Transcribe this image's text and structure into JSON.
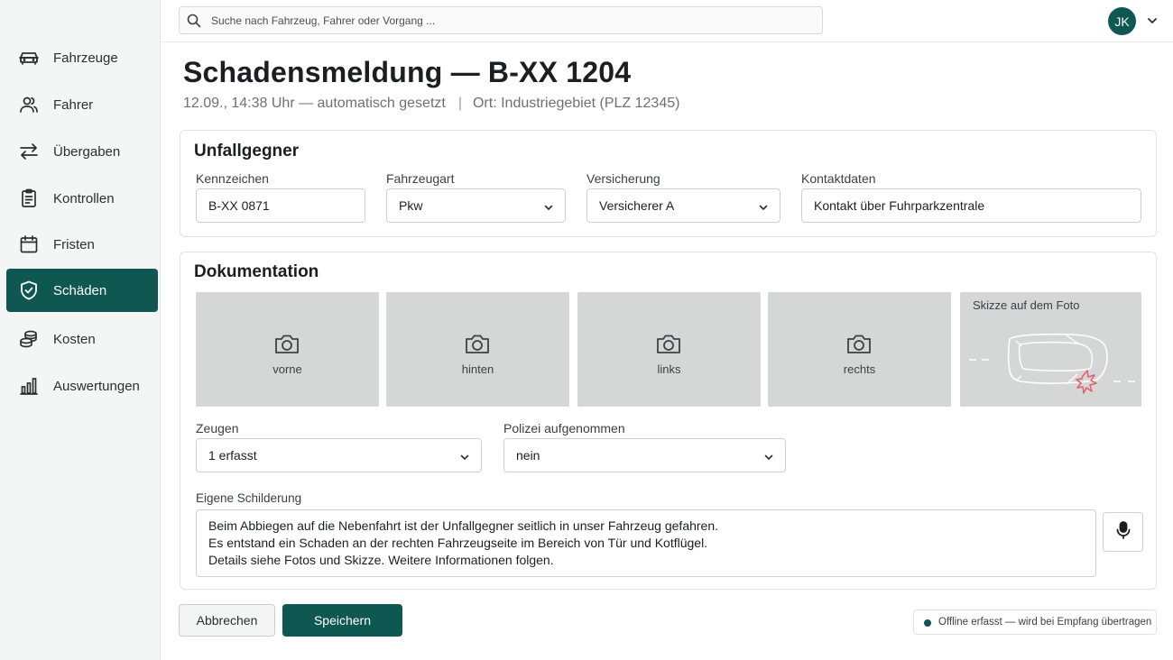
{
  "sidebar": {
    "items": [
      {
        "label": "Fahrzeuge",
        "icon": "car-icon"
      },
      {
        "label": "Fahrer",
        "icon": "users-icon"
      },
      {
        "label": "Übergaben",
        "icon": "swap-arrows-icon"
      },
      {
        "label": "Kontrollen",
        "icon": "clipboard-icon"
      },
      {
        "label": "Fristen",
        "icon": "calendar-icon"
      },
      {
        "label": "Schäden",
        "icon": "shield-icon",
        "active": true
      },
      {
        "label": "Kosten",
        "icon": "coins-icon"
      },
      {
        "label": "Auswertungen",
        "icon": "bar-chart-icon"
      }
    ]
  },
  "topbar": {
    "search_placeholder": "Suche nach Fahrzeug, Fahrer oder Vorgang ...",
    "avatar_initials": "JK"
  },
  "header": {
    "title": "Schadensmeldung — B-XX 1204",
    "timestamp": "12.09., 14:38 Uhr — automatisch gesetzt",
    "separator": "|",
    "location": "Ort: Industriegebiet (PLZ 12345)"
  },
  "opponent": {
    "title": "Unfallgegner",
    "plate_label": "Kennzeichen",
    "plate_value": "B-XX 0871",
    "vehicle_type_label": "Fahrzeugart",
    "vehicle_type_value": "Pkw",
    "insurance_label": "Versicherung",
    "insurance_value": "Versicherer A",
    "contact_label": "Kontaktdaten",
    "contact_value": "Kontakt über Fuhrparkzentrale"
  },
  "documentation": {
    "title": "Dokumentation",
    "photos": [
      {
        "caption": "vorne",
        "icon": "camera-icon"
      },
      {
        "caption": "hinten",
        "icon": "camera-icon"
      },
      {
        "caption": "links",
        "icon": "camera-icon"
      },
      {
        "caption": "rechts",
        "icon": "camera-icon"
      }
    ],
    "sketch_title": "Skizze auf dem Foto",
    "witnesses_label": "Zeugen",
    "witnesses_value": "1 erfasst",
    "police_label": "Polizei aufgenommen",
    "police_value": "nein",
    "statement_label": "Eigene Schilderung",
    "statement_lines": [
      "Beim Abbiegen auf die Nebenfahrt ist der Unfallgegner seitlich in unser Fahrzeug gefahren.",
      "Es entstand ein Schaden an der rechten Fahrzeugseite im Bereich von Tür und Kotflügel.",
      "Details siehe Fotos und Skizze. Weitere Informationen folgen."
    ]
  },
  "footer": {
    "cancel_label": "Abbrechen",
    "save_label": "Speichern",
    "status_text": "Offline erfasst — wird bei Empfang übertragen"
  },
  "colors": {
    "accent": "#0f5751",
    "photo_placeholder": "#d5d6d6",
    "impact_marker": "#e0606a"
  }
}
